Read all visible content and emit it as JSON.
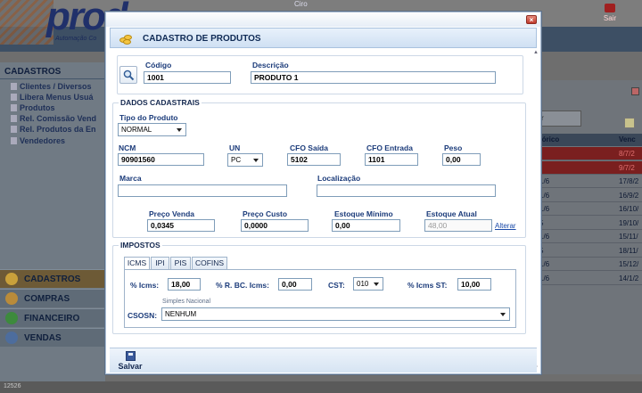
{
  "background": {
    "logo": "prod",
    "logo_subtitle": "Automação Co",
    "top_text": "Ciro",
    "exit_label": "Sair",
    "sidebar_title": "CADASTROS",
    "sidebar_items": [
      "Clientes / Diversos",
      "Libera Menus Usuá",
      "Produtos",
      "Rel. Comissão Vend",
      "Rel. Produtos da En",
      "Vendedores"
    ],
    "menu": [
      "CADASTROS",
      "COMPRAS",
      "FINANCEIRO",
      "VENDAS"
    ],
    "right_headers": [
      "tórico",
      "Venc"
    ],
    "right_search": "r",
    "right_rows": [
      {
        "a": "",
        "b": "8/7/2"
      },
      {
        "a": "",
        "b": "9/7/2"
      },
      {
        "a": "1/6",
        "b": "17/8/2"
      },
      {
        "a": "1/6",
        "b": "16/9/2"
      },
      {
        "a": "1/6",
        "b": "16/10/"
      },
      {
        "a": "5",
        "b": "19/10/"
      },
      {
        "a": "1/6",
        "b": "15/11/"
      },
      {
        "a": "5",
        "b": "18/11/"
      },
      {
        "a": "1/6",
        "b": "15/12/"
      },
      {
        "a": "1/6",
        "b": "14/1/2"
      }
    ],
    "status_text": "12526"
  },
  "modal": {
    "title": "CADASTRO DE PRODUTOS",
    "close_symbol": "×",
    "codigo": {
      "label": "Código",
      "value": "1001"
    },
    "descricao": {
      "label": "Descrição",
      "value": "PRODUTO 1"
    },
    "dados_legend": "DADOS CADASTRAIS",
    "tipo_produto": {
      "label": "Tipo do Produto",
      "value": "NORMAL"
    },
    "ncm": {
      "label": "NCM",
      "value": "90901560"
    },
    "un": {
      "label": "UN",
      "value": "PC"
    },
    "cfo_saida": {
      "label": "CFO Saída",
      "value": "5102"
    },
    "cfo_entrada": {
      "label": "CFO Entrada",
      "value": "1101"
    },
    "peso": {
      "label": "Peso",
      "value": "0,00"
    },
    "marca": {
      "label": "Marca",
      "value": ""
    },
    "localizacao": {
      "label": "Localização",
      "value": ""
    },
    "preco_venda": {
      "label": "Preço Venda",
      "value": "0,0345"
    },
    "preco_custo": {
      "label": "Preço Custo",
      "value": "0,0000"
    },
    "estoque_minimo": {
      "label": "Estoque Mínimo",
      "value": "0,00"
    },
    "estoque_atual": {
      "label": "Estoque Atual",
      "value": "48,00"
    },
    "alterar_link": "Alterar",
    "impostos_legend": "IMPOSTOS",
    "tabs": [
      "ICMS",
      "IPI",
      "PIS",
      "COFINS"
    ],
    "icms": {
      "label": "% Icms:",
      "value": "18,00"
    },
    "rbc_icms": {
      "label": "% R. BC. Icms:",
      "value": "0,00"
    },
    "cst": {
      "label": "CST:",
      "value": "010"
    },
    "icms_st": {
      "label": "% Icms ST:",
      "value": "10,00"
    },
    "simples_hint": "Simples Nacional",
    "csosn": {
      "label": "CSOSN:",
      "value": "NENHUM"
    },
    "save_label": "Salvar"
  }
}
